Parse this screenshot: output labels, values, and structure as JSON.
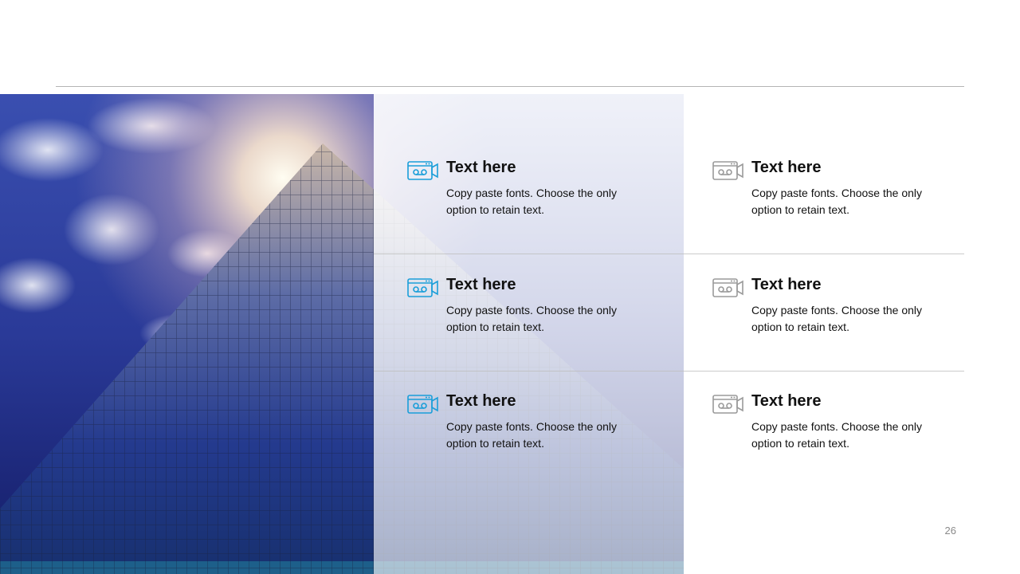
{
  "slide": {
    "page_number": "26",
    "accent_color": "#1a9ed9",
    "muted_icon_color": "#9a9a9a"
  },
  "items": [
    {
      "title": "Text here",
      "body": "Copy paste fonts. Choose the only option to retain text.",
      "icon": "video-mail-icon",
      "style": "accent"
    },
    {
      "title": "Text here",
      "body": "Copy paste fonts. Choose the only option to retain text.",
      "icon": "video-mail-icon",
      "style": "muted"
    },
    {
      "title": "Text here",
      "body": "Copy paste fonts. Choose the only option to retain text.",
      "icon": "video-mail-icon",
      "style": "accent"
    },
    {
      "title": "Text here",
      "body": "Copy paste fonts. Choose the only option to retain text.",
      "icon": "video-mail-icon",
      "style": "muted"
    },
    {
      "title": "Text here",
      "body": "Copy paste fonts. Choose the only option to retain text.",
      "icon": "video-mail-icon",
      "style": "accent"
    },
    {
      "title": "Text here",
      "body": "Copy paste fonts. Choose the only option to retain text.",
      "icon": "video-mail-icon",
      "style": "muted"
    }
  ]
}
